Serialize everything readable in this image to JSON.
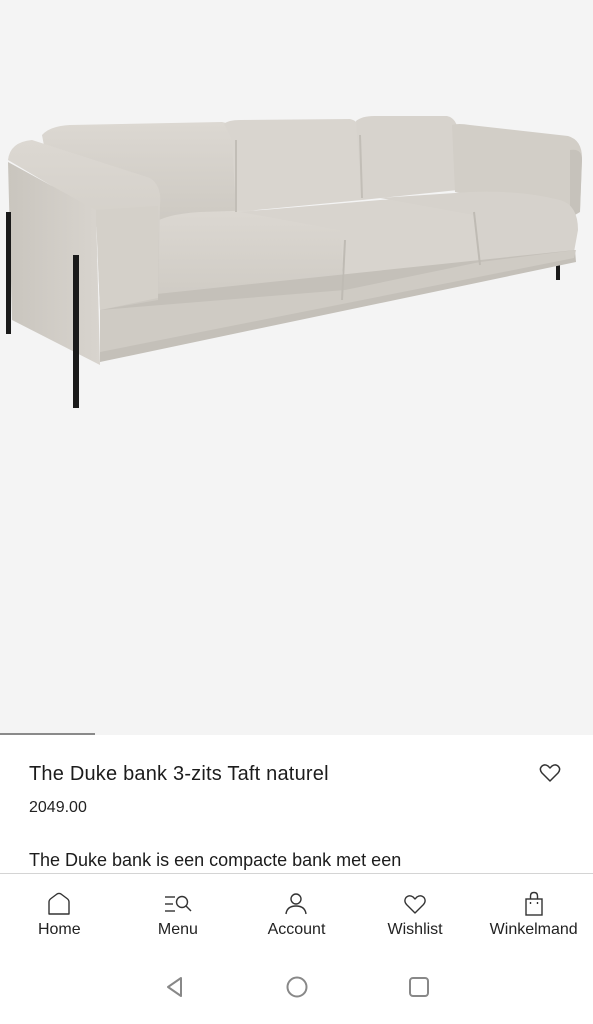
{
  "product": {
    "title": "The Duke bank 3-zits Taft naturel",
    "price": "2049.00",
    "description": "The Duke bank is een compacte bank met een",
    "image_alt": "The Duke bank 3-zits Taft naturel",
    "gallery_progress_fraction": 0.16
  },
  "bottom_nav": {
    "items": [
      {
        "label": "Home",
        "icon": "home-icon"
      },
      {
        "label": "Menu",
        "icon": "menu-search-icon"
      },
      {
        "label": "Account",
        "icon": "account-icon"
      },
      {
        "label": "Wishlist",
        "icon": "heart-icon"
      },
      {
        "label": "Winkelmand",
        "icon": "shopping-bag-icon"
      }
    ]
  },
  "system_bar": {
    "buttons": [
      "back-icon",
      "home-circle-icon",
      "recents-icon"
    ]
  },
  "colors": {
    "image_background": "#f4f4f4",
    "text": "#1c1c1c",
    "divider": "#d4d4d4",
    "sofa_fabric": "#d6d2cc",
    "sofa_legs": "#1a1a1a"
  }
}
